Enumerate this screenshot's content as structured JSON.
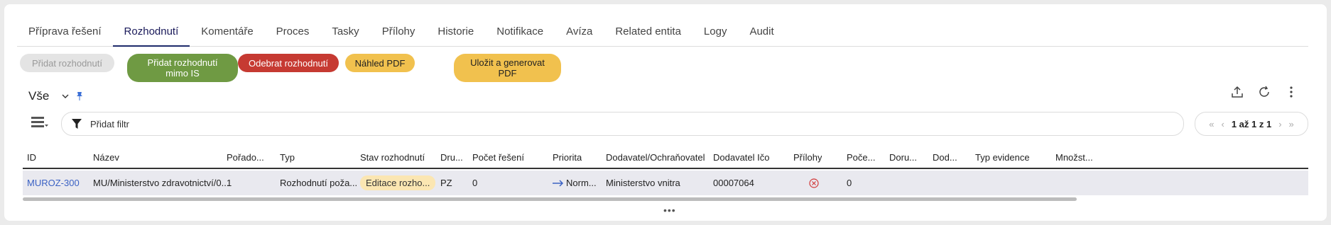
{
  "tabs": [
    {
      "label": "Příprava řešení",
      "active": false
    },
    {
      "label": "Rozhodnutí",
      "active": true
    },
    {
      "label": "Komentáře",
      "active": false
    },
    {
      "label": "Proces",
      "active": false
    },
    {
      "label": "Tasky",
      "active": false
    },
    {
      "label": "Přílohy",
      "active": false
    },
    {
      "label": "Historie",
      "active": false
    },
    {
      "label": "Notifikace",
      "active": false
    },
    {
      "label": "Avíza",
      "active": false
    },
    {
      "label": "Related entita",
      "active": false
    },
    {
      "label": "Logy",
      "active": false
    },
    {
      "label": "Audit",
      "active": false
    }
  ],
  "actions": {
    "add_decision": "Přidat rozhodnutí",
    "add_decision_outside": "Přidat rozhodnutí\nmimo IS",
    "remove_decision": "Odebrat rozhodnutí",
    "pdf_preview": "Náhled PDF",
    "save_generate": "Uložit a generovat\nPDF"
  },
  "view": {
    "selected": "Vše"
  },
  "filter": {
    "placeholder": "Přidat filtr"
  },
  "pager": {
    "text": "1 až 1 z 1"
  },
  "table": {
    "columns": [
      "ID",
      "Název",
      "Pořado...",
      "Typ",
      "Stav rozhodnutí",
      "Dru...",
      "Počet řešení",
      "Priorita",
      "Dodavatel/Ochraňovatel",
      "Dodavatel Ičo",
      "Přílohy",
      "Poče...",
      "Doru...",
      "Dod...",
      "Typ evidence",
      "Množst..."
    ],
    "rows": [
      {
        "id": "MUROZ-300",
        "nazev": "MU/Ministerstvo zdravotnictví/0...",
        "poradi": "1",
        "typ": "Rozhodnutí poža...",
        "stav": "Editace rozho...",
        "druh": "PZ",
        "pocet_reseni": "0",
        "priorita": "Norm...",
        "dodavatel": "Ministerstvo vnitra",
        "ico": "00007064",
        "pocet": "0"
      }
    ]
  },
  "colors": {
    "green": "#6f9a43",
    "red": "#c63a32",
    "yellow": "#f1c14e",
    "link": "#3b62c4",
    "tab_active": "#1d2a6b"
  }
}
